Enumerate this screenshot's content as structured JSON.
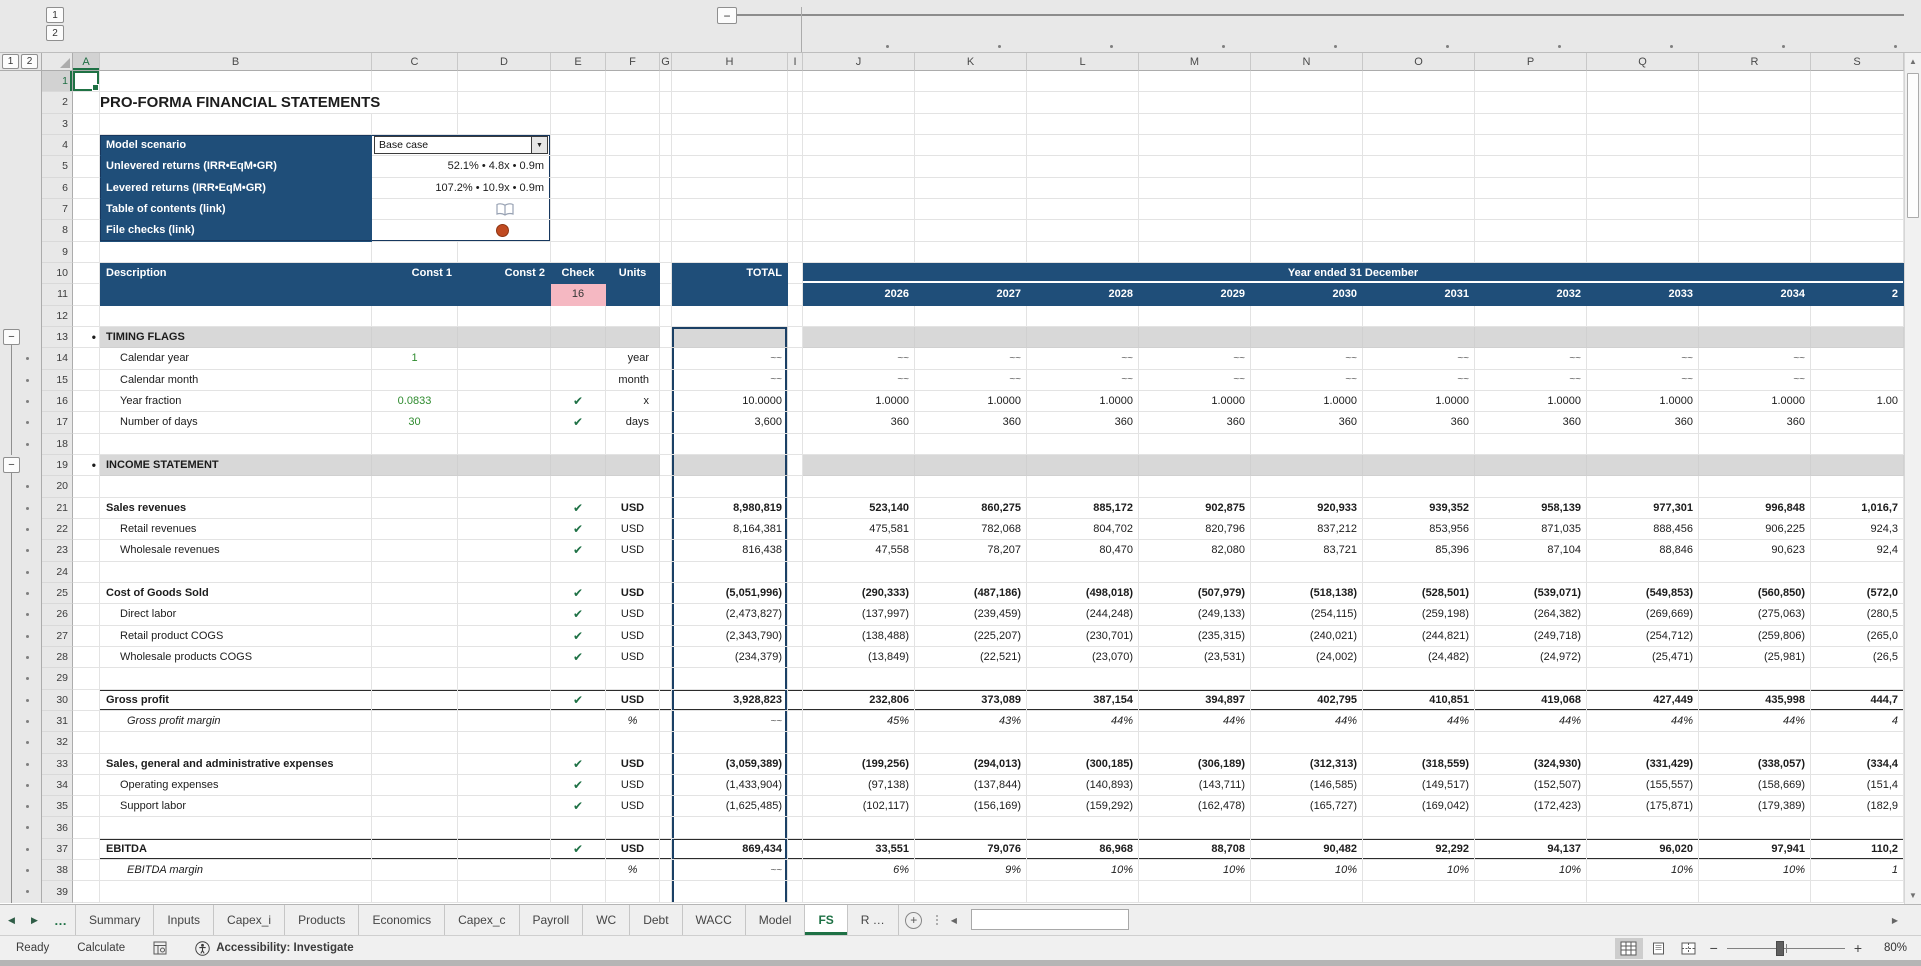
{
  "columns": [
    "A",
    "B",
    "C",
    "D",
    "E",
    "F",
    "G",
    "H",
    "I",
    "J",
    "K",
    "L",
    "M",
    "N",
    "O",
    "P",
    "Q",
    "R",
    "S"
  ],
  "row_count": 39,
  "selected_cell": "A1",
  "outline": {
    "col_level_1": "1",
    "col_level_2": "2",
    "row_level_1": "1",
    "row_level_2": "2",
    "collapse": "−"
  },
  "colors": {
    "navy": "#1F4E79",
    "band_gray": "#D8D8D8",
    "input_green": "#2E8B2E",
    "check_green": "#1E7145",
    "pink": "#F5B8C2",
    "accent_green": "#217346",
    "file_check_red": "#C04A21"
  },
  "sheet": {
    "title": "PRO-FORMA FINANCIAL STATEMENTS",
    "symbols": {
      "check": "✔",
      "tilde": "~~",
      "bullet": "•",
      "dropdown_arrow": "▼"
    },
    "panel": {
      "rows": [
        {
          "label": "Model scenario",
          "type": "dropdown",
          "value": "Base case"
        },
        {
          "label": "Unlevered returns (IRR•EqM•GR)",
          "type": "value",
          "value": "52.1% • 4.8x • 0.9m"
        },
        {
          "label": "Levered returns (IRR•EqM•GR)",
          "type": "value",
          "value": "107.2% • 10.9x • 0.9m"
        },
        {
          "label": "Table of contents (link)",
          "type": "book",
          "value": ""
        },
        {
          "label": "File checks (link)",
          "type": "circle",
          "value": ""
        }
      ]
    },
    "header": {
      "description": "Description",
      "const1": "Const 1",
      "const2": "Const 2",
      "check": "Check",
      "units": "Units",
      "total": "TOTAL",
      "band": "Year ended 31 December",
      "check_count": "16",
      "years": [
        "2026",
        "2027",
        "2028",
        "2029",
        "2030",
        "2031",
        "2032",
        "2033",
        "2034",
        "2"
      ]
    },
    "rows": [
      {
        "n": 13,
        "sec": "TIMING FLAGS"
      },
      {
        "n": 14,
        "label": "Calendar year",
        "lvl": 1,
        "c1": "1",
        "chk": false,
        "unit": "year",
        "ua": "r",
        "total": "~~",
        "years": [
          "~~",
          "~~",
          "~~",
          "~~",
          "~~",
          "~~",
          "~~",
          "~~",
          "~~",
          ""
        ]
      },
      {
        "n": 15,
        "label": "Calendar month",
        "lvl": 1,
        "c1": "",
        "chk": false,
        "unit": "month",
        "ua": "r",
        "total": "~~",
        "years": [
          "~~",
          "~~",
          "~~",
          "~~",
          "~~",
          "~~",
          "~~",
          "~~",
          "~~",
          ""
        ]
      },
      {
        "n": 16,
        "label": "Year fraction",
        "lvl": 1,
        "c1": "0.0833",
        "chk": true,
        "unit": "x",
        "ua": "r",
        "total": "10.0000",
        "years": [
          "1.0000",
          "1.0000",
          "1.0000",
          "1.0000",
          "1.0000",
          "1.0000",
          "1.0000",
          "1.0000",
          "1.0000",
          "1.00"
        ]
      },
      {
        "n": 17,
        "label": "Number of days",
        "lvl": 1,
        "c1": "30",
        "chk": true,
        "unit": "days",
        "ua": "r",
        "total": "3,600",
        "years": [
          "360",
          "360",
          "360",
          "360",
          "360",
          "360",
          "360",
          "360",
          "360",
          ""
        ]
      },
      {
        "n": 19,
        "sec": "INCOME STATEMENT"
      },
      {
        "n": 21,
        "label": "Sales revenues",
        "lvl": 0,
        "c1": "",
        "chk": true,
        "unit": "USD",
        "ua": "c",
        "total": "8,980,819",
        "years": [
          "523,140",
          "860,275",
          "885,172",
          "902,875",
          "920,933",
          "939,352",
          "958,139",
          "977,301",
          "996,848",
          "1,016,7"
        ]
      },
      {
        "n": 22,
        "label": "Retail revenues",
        "lvl": 1,
        "c1": "",
        "chk": true,
        "unit": "USD",
        "ua": "c",
        "total": "8,164,381",
        "years": [
          "475,581",
          "782,068",
          "804,702",
          "820,796",
          "837,212",
          "853,956",
          "871,035",
          "888,456",
          "906,225",
          "924,3"
        ]
      },
      {
        "n": 23,
        "label": "Wholesale revenues",
        "lvl": 1,
        "c1": "",
        "chk": true,
        "unit": "USD",
        "ua": "c",
        "total": "816,438",
        "years": [
          "47,558",
          "78,207",
          "80,470",
          "82,080",
          "83,721",
          "85,396",
          "87,104",
          "88,846",
          "90,623",
          "92,4"
        ]
      },
      {
        "n": 25,
        "label": "Cost of Goods Sold",
        "lvl": 0,
        "c1": "",
        "chk": true,
        "unit": "USD",
        "ua": "c",
        "total": "(5,051,996)",
        "years": [
          "(290,333)",
          "(487,186)",
          "(498,018)",
          "(507,979)",
          "(518,138)",
          "(528,501)",
          "(539,071)",
          "(549,853)",
          "(560,850)",
          "(572,0"
        ]
      },
      {
        "n": 26,
        "label": "Direct labor",
        "lvl": 1,
        "c1": "",
        "chk": true,
        "unit": "USD",
        "ua": "c",
        "total": "(2,473,827)",
        "years": [
          "(137,997)",
          "(239,459)",
          "(244,248)",
          "(249,133)",
          "(254,115)",
          "(259,198)",
          "(264,382)",
          "(269,669)",
          "(275,063)",
          "(280,5"
        ]
      },
      {
        "n": 27,
        "label": "Retail product COGS",
        "lvl": 1,
        "c1": "",
        "chk": true,
        "unit": "USD",
        "ua": "c",
        "total": "(2,343,790)",
        "years": [
          "(138,488)",
          "(225,207)",
          "(230,701)",
          "(235,315)",
          "(240,021)",
          "(244,821)",
          "(249,718)",
          "(254,712)",
          "(259,806)",
          "(265,0"
        ]
      },
      {
        "n": 28,
        "label": "Wholesale products COGS",
        "lvl": 1,
        "c1": "",
        "chk": true,
        "unit": "USD",
        "ua": "c",
        "total": "(234,379)",
        "years": [
          "(13,849)",
          "(22,521)",
          "(23,070)",
          "(23,531)",
          "(24,002)",
          "(24,482)",
          "(24,972)",
          "(25,471)",
          "(25,981)",
          "(26,5"
        ]
      },
      {
        "n": 30,
        "label": "Gross profit",
        "lvl": 0,
        "c1": "",
        "chk": true,
        "unit": "USD",
        "ua": "c",
        "total": "3,928,823",
        "bt": true,
        "bb": true,
        "years": [
          "232,806",
          "373,089",
          "387,154",
          "394,897",
          "402,795",
          "410,851",
          "419,068",
          "427,449",
          "435,998",
          "444,7"
        ]
      },
      {
        "n": 31,
        "label": "Gross profit margin",
        "lvl": 2,
        "c1": "",
        "chk": false,
        "unit": "%",
        "ua": "c",
        "total": "~~",
        "years": [
          "45%",
          "43%",
          "44%",
          "44%",
          "44%",
          "44%",
          "44%",
          "44%",
          "44%",
          "4"
        ]
      },
      {
        "n": 33,
        "label": "Sales, general and administrative expenses",
        "lvl": 0,
        "c1": "",
        "chk": true,
        "unit": "USD",
        "ua": "c",
        "total": "(3,059,389)",
        "years": [
          "(199,256)",
          "(294,013)",
          "(300,185)",
          "(306,189)",
          "(312,313)",
          "(318,559)",
          "(324,930)",
          "(331,429)",
          "(338,057)",
          "(334,4"
        ]
      },
      {
        "n": 34,
        "label": "Operating expenses",
        "lvl": 1,
        "c1": "",
        "chk": true,
        "unit": "USD",
        "ua": "c",
        "total": "(1,433,904)",
        "years": [
          "(97,138)",
          "(137,844)",
          "(140,893)",
          "(143,711)",
          "(146,585)",
          "(149,517)",
          "(152,507)",
          "(155,557)",
          "(158,669)",
          "(151,4"
        ]
      },
      {
        "n": 35,
        "label": "Support labor",
        "lvl": 1,
        "c1": "",
        "chk": true,
        "unit": "USD",
        "ua": "c",
        "total": "(1,625,485)",
        "years": [
          "(102,117)",
          "(156,169)",
          "(159,292)",
          "(162,478)",
          "(165,727)",
          "(169,042)",
          "(172,423)",
          "(175,871)",
          "(179,389)",
          "(182,9"
        ]
      },
      {
        "n": 37,
        "label": "EBITDA",
        "lvl": 0,
        "c1": "",
        "chk": true,
        "unit": "USD",
        "ua": "c",
        "total": "869,434",
        "bt": true,
        "bb": true,
        "years": [
          "33,551",
          "79,076",
          "86,968",
          "88,708",
          "90,482",
          "92,292",
          "94,137",
          "96,020",
          "97,941",
          "110,2"
        ]
      },
      {
        "n": 38,
        "label": "EBITDA margin",
        "lvl": 2,
        "c1": "",
        "chk": false,
        "unit": "%",
        "ua": "c",
        "total": "~~",
        "years": [
          "6%",
          "9%",
          "10%",
          "10%",
          "10%",
          "10%",
          "10%",
          "10%",
          "10%",
          "1"
        ]
      }
    ]
  },
  "tabs": {
    "nav_left": "◀",
    "nav_right": "▶",
    "more": "…",
    "add": "+",
    "list": [
      {
        "label": "Summary"
      },
      {
        "label": "Inputs"
      },
      {
        "label": "Capex_i"
      },
      {
        "label": "Products"
      },
      {
        "label": "Economics"
      },
      {
        "label": "Capex_c"
      },
      {
        "label": "Payroll"
      },
      {
        "label": "WC"
      },
      {
        "label": "Debt"
      },
      {
        "label": "WACC"
      },
      {
        "label": "Model"
      },
      {
        "label": "FS",
        "active": true
      },
      {
        "label": "R …"
      }
    ]
  },
  "status": {
    "ready": "Ready",
    "calculate": "Calculate",
    "accessibility": "Accessibility: Investigate",
    "zoom_out": "−",
    "zoom_in": "+",
    "zoom": "80%"
  }
}
